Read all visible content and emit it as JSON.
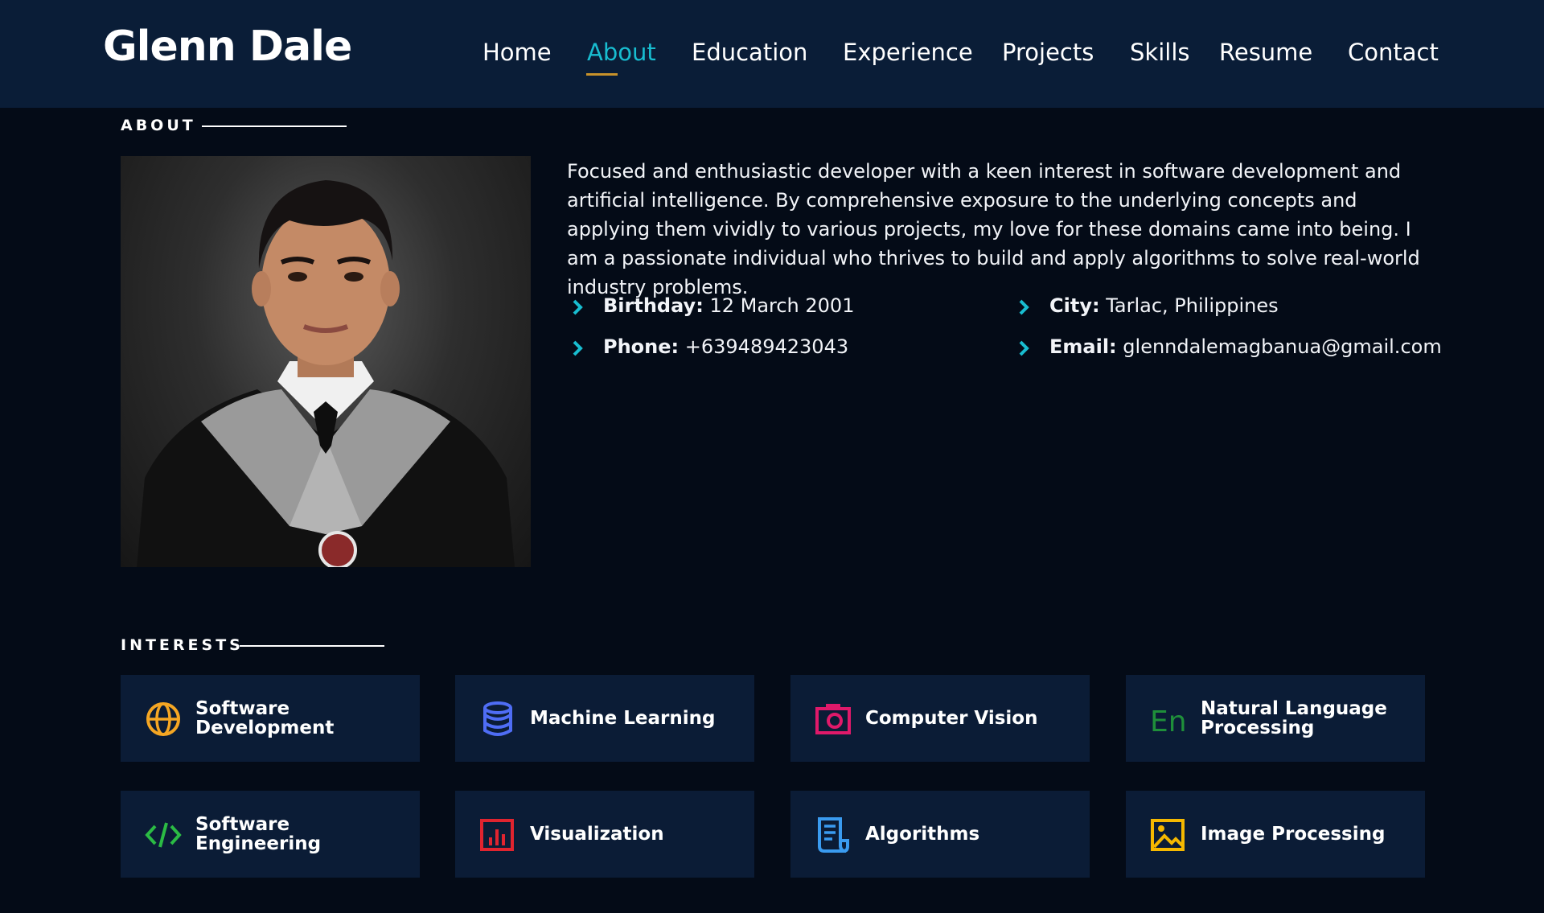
{
  "header": {
    "logo": "Glenn Dale",
    "nav": [
      "Home",
      "About",
      "Education",
      "Experience",
      "Projects",
      "Skills",
      "Resume",
      "Contact"
    ],
    "active_nav": "About"
  },
  "about": {
    "title": "ABOUT",
    "bio": "Focused and enthusiastic developer with a keen interest in software development and artificial intelligence. By comprehensive exposure to the underlying concepts and applying them vividly to various projects, my love for these domains came into being. I am a passionate individual who thrives to build and apply algorithms to solve real-world industry problems.",
    "details": {
      "birthday": {
        "label": "Birthday:",
        "value": "12 March 2001"
      },
      "city": {
        "label": "City:",
        "value": "Tarlac, Philippines"
      },
      "phone": {
        "label": "Phone:",
        "value": "+639489423043"
      },
      "email": {
        "label": "Email:",
        "value": "glenndalemagbanua@gmail.com"
      }
    }
  },
  "interests": {
    "title": "INTERESTS",
    "items": [
      {
        "label": "Software Development",
        "icon": "globe-icon",
        "color": "#f5a623"
      },
      {
        "label": "Machine Learning",
        "icon": "database-icon",
        "color": "#4f6df5"
      },
      {
        "label": "Computer Vision",
        "icon": "camera-icon",
        "color": "#e0196a"
      },
      {
        "label": "Natural Language Processing",
        "icon": "language-icon",
        "color": "#1f8f3a"
      },
      {
        "label": "Software Engineering",
        "icon": "code-icon",
        "color": "#2bbb44"
      },
      {
        "label": "Visualization",
        "icon": "bar-chart-icon",
        "color": "#e0242f"
      },
      {
        "label": "Algorithms",
        "icon": "document-icon",
        "color": "#3a9bf0"
      },
      {
        "label": "Image Processing",
        "icon": "image-icon",
        "color": "#f5b800"
      }
    ]
  },
  "colors": {
    "accent": "#18bdd0",
    "underline": "#c8922a",
    "header_bg": "#0a1d37",
    "page_bg": "#040b17",
    "card_bg": "#0b1c36"
  }
}
